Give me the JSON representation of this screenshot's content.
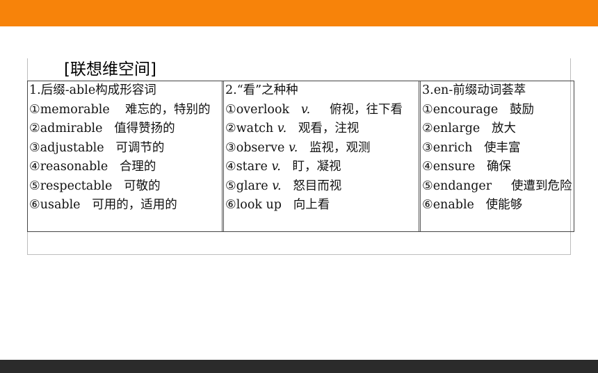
{
  "section_title": "[联想维空间]",
  "columns": [
    {
      "header": "1.后缀-able构成形容词",
      "items": [
        {
          "word": "①memorable",
          "meaning": "难忘的，特别的"
        },
        {
          "word": "②admirable",
          "meaning": "值得赞扬的"
        },
        {
          "word": "③adjustable",
          "meaning": "可调节的"
        },
        {
          "word": "④reasonable",
          "meaning": "合理的"
        },
        {
          "word": "⑤respectable",
          "meaning": "可敬的"
        },
        {
          "word": "⑥usable",
          "meaning": "可用的，适用的"
        }
      ]
    },
    {
      "header": "2.“看”之种种",
      "items": [
        {
          "word": "①overlook",
          "pos": "v.",
          "meaning": "俯视，往下看"
        },
        {
          "word": "②watch",
          "pos": "v.",
          "meaning": "观看，注视"
        },
        {
          "word": "③observe",
          "pos": "v.",
          "meaning": "监视，观测"
        },
        {
          "word": "④stare",
          "pos": "v.",
          "meaning": "盯，凝视"
        },
        {
          "word": "⑤glare",
          "pos": "v.",
          "meaning": "怒目而视"
        },
        {
          "word": "⑥look up",
          "meaning": "向上看"
        }
      ]
    },
    {
      "header": "3.en-前缀动词荟萃",
      "items": [
        {
          "word": "①encourage",
          "meaning": "鼓励"
        },
        {
          "word": "②enlarge",
          "meaning": "放大"
        },
        {
          "word": "③enrich",
          "meaning": "使丰富"
        },
        {
          "word": "④ensure",
          "meaning": "确保"
        },
        {
          "word": "⑤endanger",
          "meaning": "使遭到危险"
        },
        {
          "word": "⑥enable",
          "meaning": "使能够"
        }
      ]
    }
  ]
}
